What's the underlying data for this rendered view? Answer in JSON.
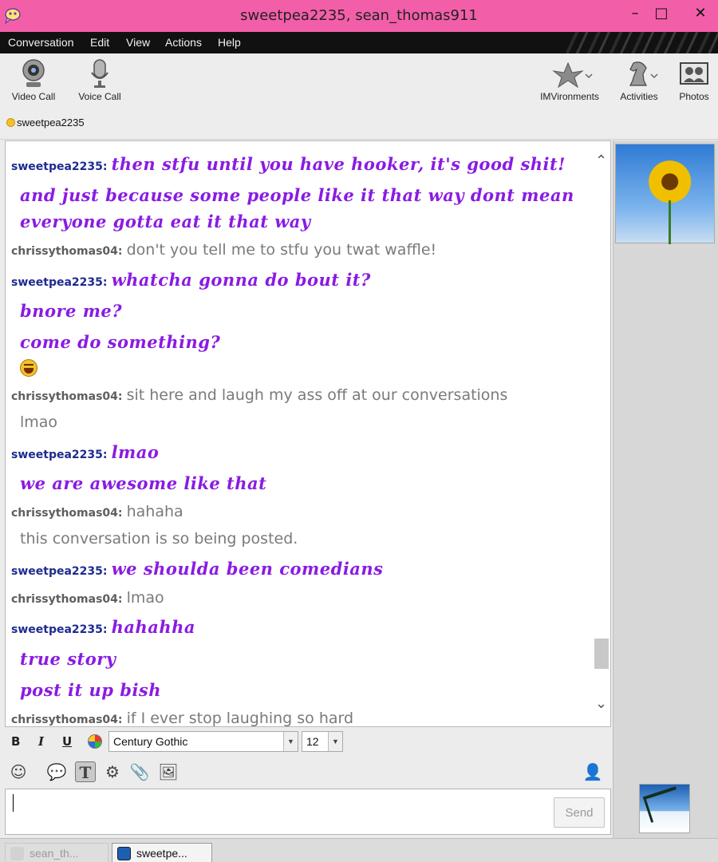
{
  "window": {
    "title": "sweetpea2235, sean_thomas911",
    "minimize": "–",
    "maximize": "□",
    "close": "✕"
  },
  "menu": [
    "Conversation",
    "Edit",
    "View",
    "Actions",
    "Help"
  ],
  "toolbar": {
    "video_call": "Video Call",
    "voice_call": "Voice Call",
    "imvironments": "IMVironments",
    "activities": "Activities",
    "photos": "Photos"
  },
  "buddy": {
    "name": "sweetpea2235",
    "status_color": "#f4c12a"
  },
  "messages": [
    {
      "sender": "sweetpea2235:",
      "text": "then stfu until you have hooker, it's good shit!"
    },
    {
      "sender": "",
      "text": "and just because some people like it that way dont mean"
    },
    {
      "sender": "",
      "text": "everyone gotta eat it that way"
    },
    {
      "sender": "chrissythomas04:",
      "text": "don't you tell me to stfu you twat waffle!"
    },
    {
      "sender": "sweetpea2235:",
      "text": "whatcha gonna do bout it?"
    },
    {
      "sender": "",
      "text": "bnore me?"
    },
    {
      "sender": "",
      "text": "come do something?"
    },
    {
      "sender": "chrissythomas04:",
      "text": "sit here and laugh my ass off at our conversations"
    },
    {
      "sender": "",
      "text": "lmao"
    },
    {
      "sender": "sweetpea2235:",
      "text": "lmao"
    },
    {
      "sender": "",
      "text": "we are awesome like that"
    },
    {
      "sender": "chrissythomas04:",
      "text": "hahaha"
    },
    {
      "sender": "",
      "text": "this conversation is so being posted."
    },
    {
      "sender": "sweetpea2235:",
      "text": "we shoulda been comedians"
    },
    {
      "sender": "chrissythomas04:",
      "text": "lmao"
    },
    {
      "sender": "sweetpea2235:",
      "text": "hahahha"
    },
    {
      "sender": "",
      "text": "true story"
    },
    {
      "sender": "",
      "text": "post it up bish"
    },
    {
      "sender": "chrissythomas04:",
      "text": "if I ever stop laughing so hard"
    }
  ],
  "format": {
    "bold": "B",
    "italic": "I",
    "underline": "U",
    "font": "Century Gothic",
    "size": "12"
  },
  "compose": {
    "send": "Send"
  },
  "taskbar": [
    "sean_th...",
    "sweetpe..."
  ],
  "colors": {
    "title_bar": "#f25fa8",
    "sweetpea_text": "#8a1be2",
    "sweetpea_name": "#1d2b8f",
    "chrissy_text": "#7a7a7a"
  }
}
